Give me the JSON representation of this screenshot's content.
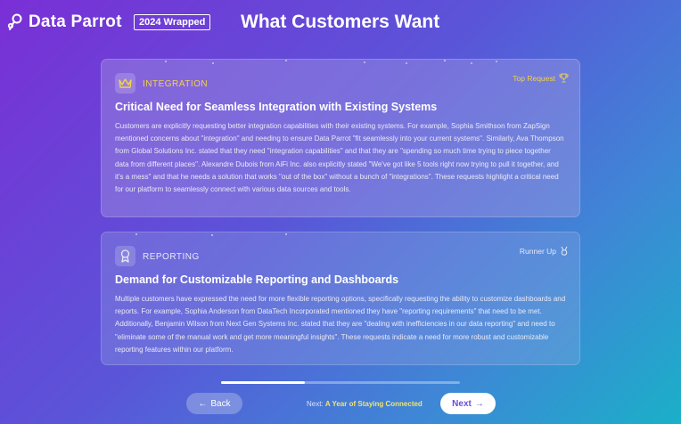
{
  "header": {
    "logo_text": "Data Parrot",
    "badge": "2024 Wrapped",
    "title": "What Customers Want"
  },
  "cards": [
    {
      "category": "INTEGRATION",
      "rank": "Top Request",
      "heading": "Critical Need for Seamless Integration with Existing Systems",
      "body": "Customers are explicitly requesting better integration capabilities with their existing systems. For example, Sophia Smithson from ZapSign mentioned concerns about \"integration\" and needing to ensure Data Parrot \"fit seamlessly into your current systems\". Similarly, Ava Thompson from Global Solutions Inc. stated that they need \"integration capabilities\" and that they are \"spending so much time trying to piece together data from different places\". Alexandre Dubois from AiFi Inc. also explicitly stated \"We've got like 5 tools right now trying to pull it together, and it's a mess\" and that he needs a solution that works \"out of the box\" without a bunch of \"integrations\". These requests highlight a critical need for our platform to seamlessly connect with various data sources and tools."
    },
    {
      "category": "REPORTING",
      "rank": "Runner Up",
      "heading": "Demand for Customizable Reporting and Dashboards",
      "body": "Multiple customers have expressed the need for more flexible reporting options, specifically requesting the ability to customize dashboards and reports. For example, Sophia Anderson from DataTech Incorporated mentioned they have \"reporting requirements\" that need to be met. Additionally, Benjamin Wilson from Next Gen Systems Inc. stated that they are \"dealing with inefficiencies in our data reporting\" and need to \"eliminate some of the manual work and get more meaningful insights\". These requests indicate a need for more robust and customizable reporting features within our platform."
    }
  ],
  "footer": {
    "progress": 0.35,
    "back_label": "Back",
    "next_prefix": "Next:",
    "next_title": "A Year of Staying Connected",
    "next_label": "Next"
  },
  "colors": {
    "accent_gold": "#f2d24a",
    "next_button_text": "#6b4fd6"
  },
  "icons": {
    "logo": "parrot-logo-icon",
    "card1": "crown-icon",
    "card1_rank": "trophy-icon",
    "card2": "award-ribbon-icon",
    "card2_rank": "medal-icon",
    "back": "arrow-left-icon",
    "next": "arrow-right-icon"
  }
}
